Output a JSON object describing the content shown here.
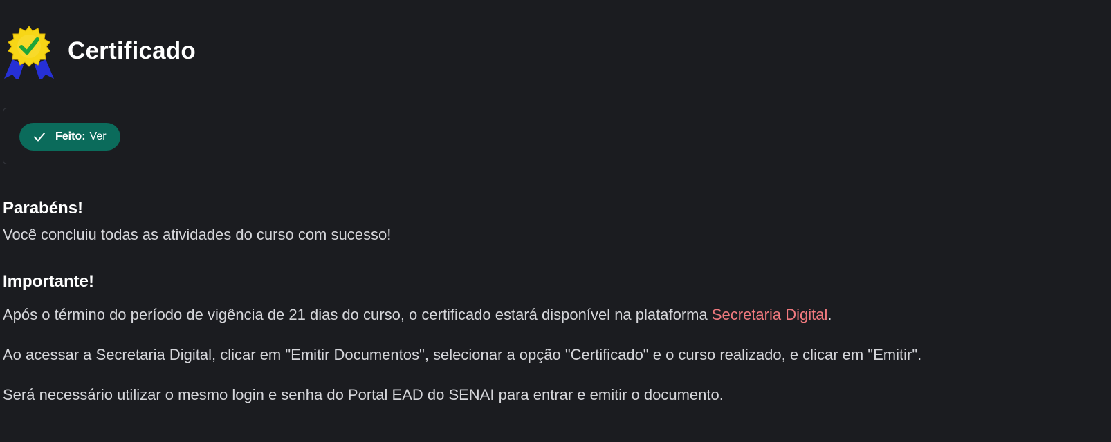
{
  "header": {
    "icon": "certificate-badge-icon",
    "title": "Certificado"
  },
  "completion": {
    "icon": "checkmark-icon",
    "status_key": "Feito:",
    "status_value": "Ver",
    "colors": {
      "pill_bg": "#0b6b5b"
    }
  },
  "content": {
    "heading1": "Parabéns!",
    "paragraph1": "Você concluiu todas as atividades do curso com sucesso!",
    "heading2": "Importante!",
    "paragraph2_before": "Após o término do período de vigência de 21 dias do curso, o certificado estará disponível na plataforma ",
    "paragraph2_link": "Secretaria Digital",
    "paragraph2_after": ".",
    "paragraph3": "Ao acessar a Secretaria Digital, clicar em \"Emitir Documentos\", selecionar a opção \"Certificado\" e o curso realizado, e clicar em \"Emitir\".",
    "paragraph4": "Será necessário utilizar o mesmo login e senha do Portal EAD do SENAI para entrar e emitir o documento.",
    "colors": {
      "link": "#f0797e"
    }
  }
}
